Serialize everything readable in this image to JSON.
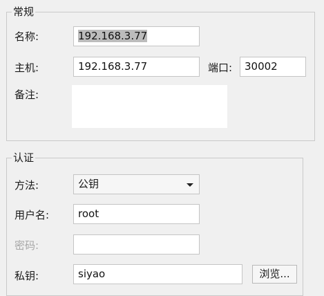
{
  "general": {
    "title": "常规",
    "name_label": "名称:",
    "name_value": "192.168.3.77",
    "host_label": "主机:",
    "host_value": "192.168.3.77",
    "port_label": "端口:",
    "port_value": "30002",
    "note_label": "备注:",
    "note_value": ""
  },
  "auth": {
    "title": "认证",
    "method_label": "方法:",
    "method_value": "公钥",
    "username_label": "用户名:",
    "username_value": "root",
    "password_label": "密码:",
    "password_value": "",
    "privkey_label": "私钥:",
    "privkey_value": "siyao",
    "browse_label": "浏览..."
  }
}
